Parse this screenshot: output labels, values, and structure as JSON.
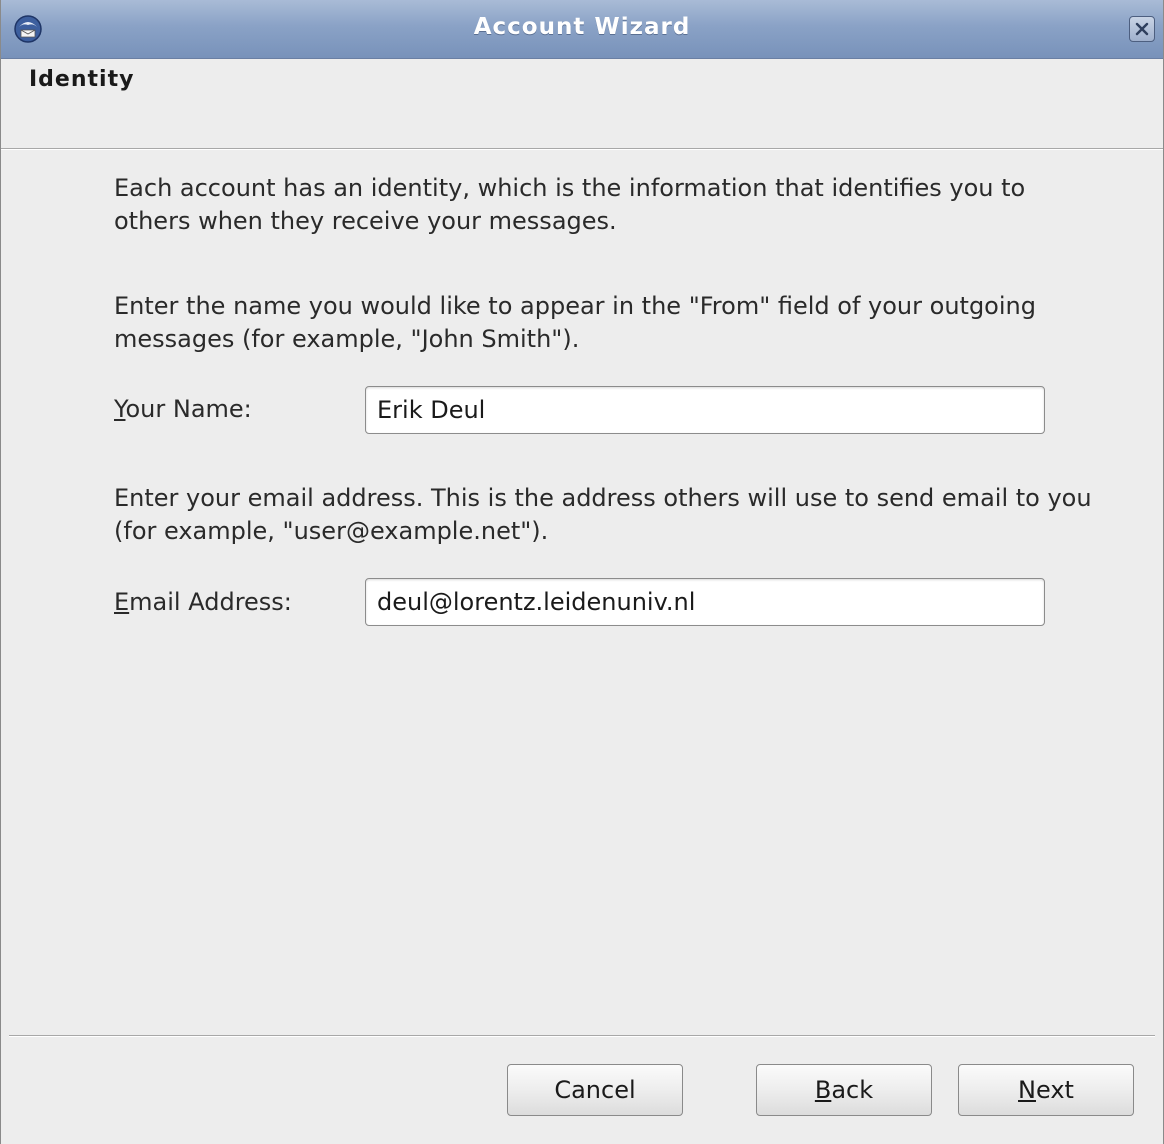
{
  "window": {
    "title": "Account Wizard",
    "app_icon": "thunderbird-icon",
    "close_icon": "close-icon"
  },
  "page": {
    "heading": "Identity",
    "intro_text": "Each account has an identity, which is the information that identifies you to others when they receive your messages.",
    "name_instructions": "Enter the name you would like to appear in the \"From\" field of your outgoing messages (for example, \"John Smith\").",
    "email_instructions": "Enter your email address. This is the address others will use to send email to you (for example, \"user@example.net\")."
  },
  "form": {
    "name_label_mnemonic": "Y",
    "name_label_rest": "our Name:",
    "name_value": "Erik Deul",
    "email_label_mnemonic": "E",
    "email_label_rest": "mail Address:",
    "email_value": "deul@lorentz.leidenuniv.nl"
  },
  "buttons": {
    "cancel_label": "Cancel",
    "back_mnemonic": "B",
    "back_rest": "ack",
    "next_mnemonic": "N",
    "next_rest": "ext"
  }
}
